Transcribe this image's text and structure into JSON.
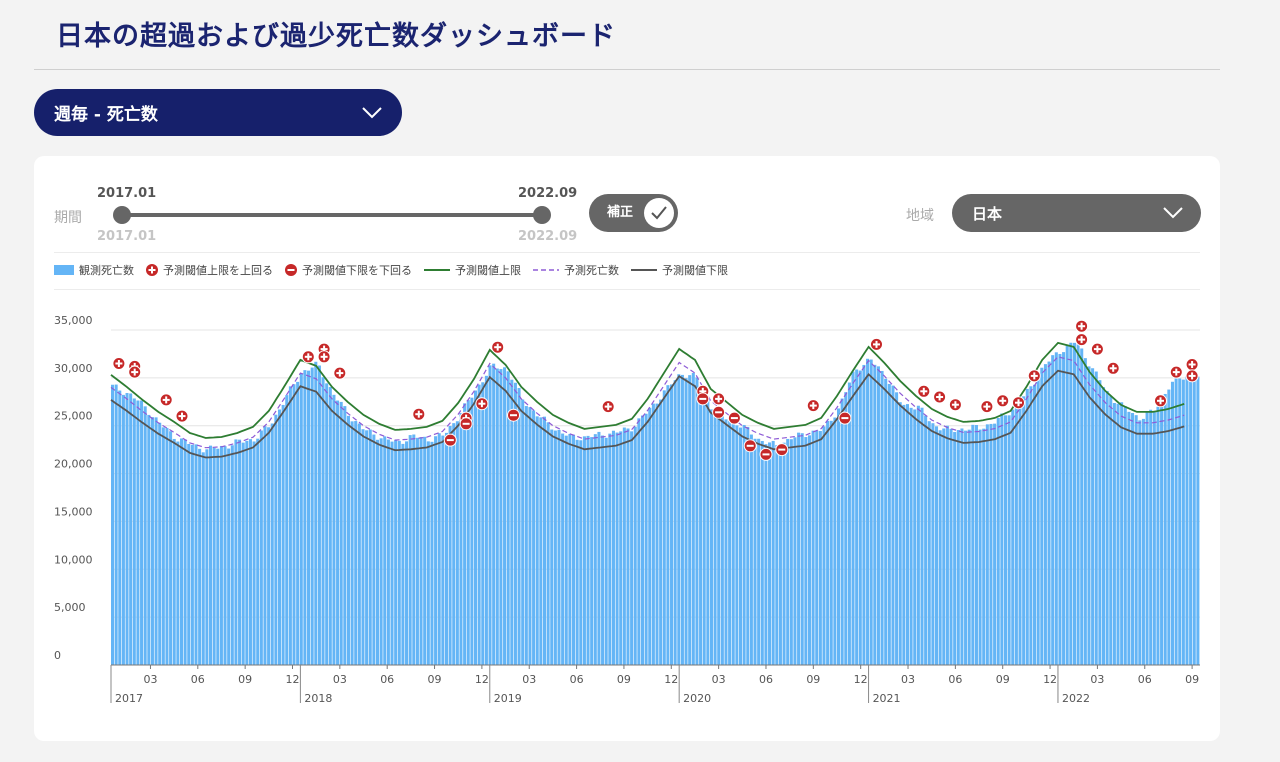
{
  "page": {
    "title": "日本の超過および過少死亡数ダッシュボード"
  },
  "metric_select": {
    "value": "週毎 - 死亡数"
  },
  "controls": {
    "period_label": "期間",
    "period_start": "2017.01",
    "period_end": "2022.09",
    "period_start_sub": "2017.01",
    "period_end_sub": "2022.09",
    "adjust_label": "補正",
    "region_label": "地域",
    "region_value": "日本"
  },
  "colors": {
    "observed": "#64b5f6",
    "above_marker": "#c62828",
    "upper_threshold": "#2e7d32",
    "expected": "#8e5bd6",
    "lower_threshold": "#555555",
    "navy": "#16206b"
  },
  "legend": [
    {
      "key": "observed",
      "label": "観測死亡数",
      "icon": "bar-swatch-icon"
    },
    {
      "key": "above",
      "label": "予測閾値上限を上回る",
      "icon": "plus-circle-icon"
    },
    {
      "key": "below",
      "label": "予測閾値下限を下回る",
      "icon": "minus-circle-icon"
    },
    {
      "key": "upper",
      "label": "予測閾値上限",
      "icon": "solid-line-icon"
    },
    {
      "key": "expected",
      "label": "予測死亡数",
      "icon": "dashed-line-icon"
    },
    {
      "key": "lower",
      "label": "予測閾値下限",
      "icon": "solid-line-icon"
    }
  ],
  "chart_data": {
    "type": "bar",
    "ylim": [
      0,
      35000
    ],
    "yticks": [
      {
        "value": 0,
        "label": "0"
      },
      {
        "value": 5000,
        "label": "5,000"
      },
      {
        "value": 10000,
        "label": "10,000"
      },
      {
        "value": 15000,
        "label": "15,000"
      },
      {
        "value": 20000,
        "label": "20,000"
      },
      {
        "value": 25000,
        "label": "25,000"
      },
      {
        "value": 30000,
        "label": "30,000"
      },
      {
        "value": 35000,
        "label": "35,000"
      }
    ],
    "x_start": "2017-01",
    "x_end": "2022-09",
    "month_ticks": [
      "03",
      "06",
      "09",
      "12"
    ],
    "years": [
      "2017",
      "2018",
      "2019",
      "2020",
      "2021",
      "2022"
    ],
    "series_names": [
      "観測死亡数",
      "予測閾値上限",
      "予測死亡数",
      "予測閾値下限"
    ],
    "expected_monthly": [
      29000,
      27800,
      26500,
      25300,
      24300,
      23200,
      22700,
      22800,
      23200,
      23800,
      25400,
      27900,
      30500,
      29900,
      27800,
      26300,
      25000,
      24100,
      23500,
      23600,
      23800,
      24400,
      26200,
      28600,
      31500,
      30000,
      27800,
      26300,
      25000,
      24200,
      23600,
      23800,
      24000,
      24600,
      26600,
      29100,
      31600,
      30500,
      27600,
      26300,
      25000,
      24200,
      23600,
      23800,
      24000,
      24700,
      26900,
      29400,
      31800,
      30200,
      28400,
      26900,
      25600,
      24800,
      24300,
      24400,
      24700,
      25400,
      27800,
      30500,
      32200,
      31800,
      29300,
      27400,
      26000,
      25300,
      25300,
      25600,
      26100
    ],
    "observed_monthly": [
      29100,
      28400,
      27100,
      25200,
      23800,
      23000,
      22500,
      22800,
      23300,
      23600,
      25100,
      28000,
      30600,
      31400,
      28300,
      26100,
      24500,
      23800,
      23200,
      23900,
      23600,
      24000,
      26200,
      28700,
      31200,
      31000,
      27700,
      26000,
      24700,
      23800,
      23800,
      24100,
      24300,
      24900,
      26700,
      28600,
      30500,
      30000,
      26800,
      25700,
      24800,
      23500,
      22900,
      23700,
      24200,
      24600,
      26800,
      30800,
      31900,
      30200,
      27200,
      27000,
      25100,
      24500,
      24700,
      24800,
      25500,
      26700,
      28600,
      31300,
      32800,
      33800,
      31200,
      28400,
      27000,
      25800,
      26500,
      29400,
      30200
    ],
    "above_markers": [
      {
        "date": "2017-01",
        "value": 31500
      },
      {
        "date": "2017-02",
        "value": 31200
      },
      {
        "date": "2017-02",
        "value": 30600
      },
      {
        "date": "2017-04",
        "value": 27700
      },
      {
        "date": "2017-05",
        "value": 26000
      },
      {
        "date": "2018-01",
        "value": 32200
      },
      {
        "date": "2018-02",
        "value": 33000
      },
      {
        "date": "2018-02",
        "value": 32200
      },
      {
        "date": "2018-03",
        "value": 30500
      },
      {
        "date": "2018-08",
        "value": 26200
      },
      {
        "date": "2018-11",
        "value": 25800
      },
      {
        "date": "2018-12",
        "value": 27300
      },
      {
        "date": "2019-01",
        "value": 33200
      },
      {
        "date": "2019-08",
        "value": 27000
      },
      {
        "date": "2020-02",
        "value": 28600
      },
      {
        "date": "2020-03",
        "value": 27800
      },
      {
        "date": "2020-09",
        "value": 27100
      },
      {
        "date": "2021-01",
        "value": 33500
      },
      {
        "date": "2021-04",
        "value": 28600
      },
      {
        "date": "2021-05",
        "value": 28000
      },
      {
        "date": "2021-06",
        "value": 27200
      },
      {
        "date": "2021-08",
        "value": 27000
      },
      {
        "date": "2021-09",
        "value": 27600
      },
      {
        "date": "2021-10",
        "value": 27400
      },
      {
        "date": "2021-11",
        "value": 30200
      },
      {
        "date": "2022-02",
        "value": 34000
      },
      {
        "date": "2022-02",
        "value": 35400
      },
      {
        "date": "2022-03",
        "value": 33000
      },
      {
        "date": "2022-04",
        "value": 31000
      },
      {
        "date": "2022-07",
        "value": 27600
      },
      {
        "date": "2022-08",
        "value": 30600
      },
      {
        "date": "2022-09",
        "value": 31400
      },
      {
        "date": "2022-09",
        "value": 30200
      }
    ],
    "below_markers": [
      {
        "date": "2018-10",
        "value": 23500
      },
      {
        "date": "2018-11",
        "value": 25200
      },
      {
        "date": "2019-02",
        "value": 26100
      },
      {
        "date": "2020-02",
        "value": 27800
      },
      {
        "date": "2020-03",
        "value": 26400
      },
      {
        "date": "2020-04",
        "value": 25800
      },
      {
        "date": "2020-05",
        "value": 22900
      },
      {
        "date": "2020-06",
        "value": 22000
      },
      {
        "date": "2020-07",
        "value": 22500
      },
      {
        "date": "2020-11",
        "value": 25800
      }
    ]
  }
}
